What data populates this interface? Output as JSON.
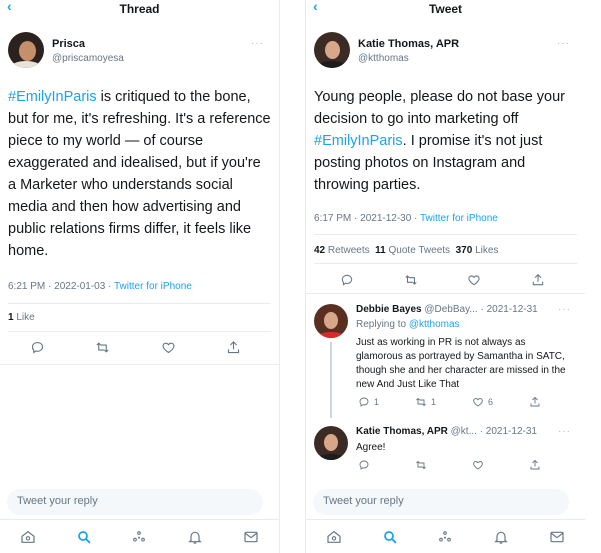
{
  "left": {
    "title": "Thread",
    "author": {
      "name": "Prisca",
      "handle": "@priscamoyesa"
    },
    "tweet": {
      "hashtag": "#EmilyInParis",
      "text": " is critiqued to the bone, but for me, it's refreshing. It's a reference piece to my world — of course exaggerated and idealised, but if you're a Marketer who understands social media and then how advertising and public relations firms differ, it feels like home.",
      "timestamp": "6:21 PM · 2022-01-03 · ",
      "source": "Twitter for iPhone"
    },
    "stats": {
      "likes_count": "1",
      "likes_label": "Like"
    },
    "reply_placeholder": "Tweet your reply"
  },
  "right": {
    "title": "Tweet",
    "author": {
      "name": "Katie Thomas, APR",
      "handle": "@ktthomas"
    },
    "tweet": {
      "text_before": "Young people, please do not base your decision to go into marketing off ",
      "hashtag": "#EmilyInParis",
      "text_after": ". I promise it's not just posting photos on Instagram and throwing parties.",
      "timestamp": "6:17 PM · 2021-12-30 · ",
      "source": "Twitter for iPhone"
    },
    "stats": {
      "retweets_count": "42",
      "retweets_label": "Retweets",
      "quotes_count": "11",
      "quotes_label": "Quote Tweets",
      "likes_count": "370",
      "likes_label": "Likes"
    },
    "replies": [
      {
        "name": "Debbie Bayes",
        "handle": "@DebBay...",
        "date": "· 2021-12-31",
        "replying_prefix": "Replying to ",
        "replying_to": "@ktthomas",
        "text": "Just as working in PR is not always as glamorous as portrayed by Samantha in SATC, though she and her character are missed in the new And Just Like That",
        "counts": {
          "reply": "1",
          "retweet": "1",
          "like": "6"
        }
      },
      {
        "name": "Katie Thomas, APR",
        "handle": "@kt...",
        "date": "· 2021-12-31",
        "text": "Agree!"
      }
    ],
    "reply_placeholder": "Tweet your reply"
  },
  "icons": {
    "back": "chevron-left-icon",
    "more": "more-icon",
    "reply": "reply-icon",
    "retweet": "retweet-icon",
    "like": "heart-icon",
    "share": "share-icon",
    "nav": [
      "home-icon",
      "search-icon",
      "spaces-icon",
      "notifications-icon",
      "messages-icon"
    ]
  },
  "colors": {
    "accent": "#1da1f2",
    "text": "#14171a",
    "muted": "#657786",
    "border": "#e6ecf0"
  }
}
